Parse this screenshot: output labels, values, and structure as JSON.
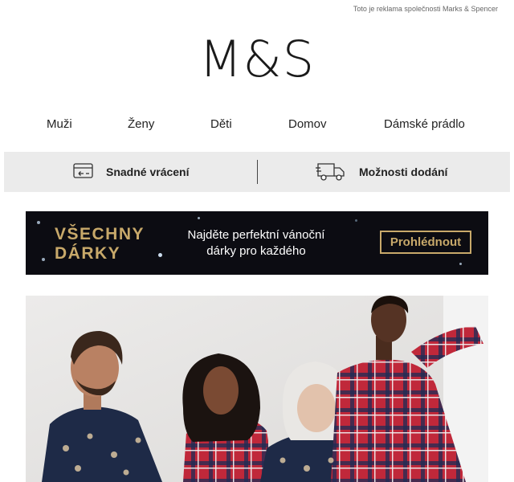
{
  "ad_note": "Toto je reklama společnosti Marks & Spencer",
  "logo": "M&S",
  "nav": {
    "items": [
      {
        "label": "Muži"
      },
      {
        "label": "Ženy"
      },
      {
        "label": "Děti"
      },
      {
        "label": "Domov"
      },
      {
        "label": "Dámské prádlo"
      }
    ]
  },
  "services": {
    "returns_label": "Snadné vrácení",
    "returns_icon": "return-card-icon",
    "delivery_label": "Možnosti dodání",
    "delivery_icon": "delivery-truck-icon"
  },
  "banner": {
    "title_line1": "VŠECHNY",
    "title_line2": "DÁRKY",
    "message": "Najděte perfektní vánoční dárky pro každého",
    "cta": "Prohlédnout",
    "gold_color": "#c8a96a"
  }
}
